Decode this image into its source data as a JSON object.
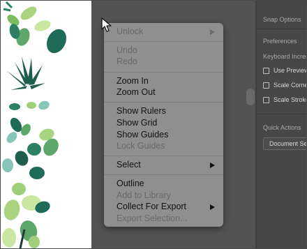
{
  "context_menu": {
    "items": [
      {
        "label": "Unlock",
        "enabled": false,
        "submenu": true
      },
      {
        "label": "Undo",
        "enabled": false
      },
      {
        "label": "Redo",
        "enabled": false
      },
      {
        "label": "Zoom In",
        "enabled": true
      },
      {
        "label": "Zoom Out",
        "enabled": true
      },
      {
        "label": "Show Rulers",
        "enabled": true
      },
      {
        "label": "Show Grid",
        "enabled": true
      },
      {
        "label": "Show Guides",
        "enabled": true
      },
      {
        "label": "Lock Guides",
        "enabled": false
      },
      {
        "label": "Select",
        "enabled": true,
        "submenu": true
      },
      {
        "label": "Outline",
        "enabled": true
      },
      {
        "label": "Add to Library",
        "enabled": false
      },
      {
        "label": "Collect For Export",
        "enabled": true,
        "submenu": true
      },
      {
        "label": "Export Selection...",
        "enabled": false
      }
    ]
  },
  "panel": {
    "snap_options": "Snap Options",
    "preferences": "Preferences",
    "keyboard_increment": "Keyboard Increm",
    "checkboxes": [
      {
        "label": "Use Preview",
        "checked": false
      },
      {
        "label": "Scale Corners",
        "checked": false
      },
      {
        "label": "Scale Strokes",
        "checked": false
      }
    ],
    "quick_actions": "Quick Actions",
    "document_setup": "Document Setup"
  },
  "colors": {
    "menu_bg": "#8f8f8f",
    "canvas_bg": "#535353",
    "panel_bg": "#474747",
    "leaf_dark": "#1f6b57",
    "leaf_light": "#9fcf7a"
  }
}
